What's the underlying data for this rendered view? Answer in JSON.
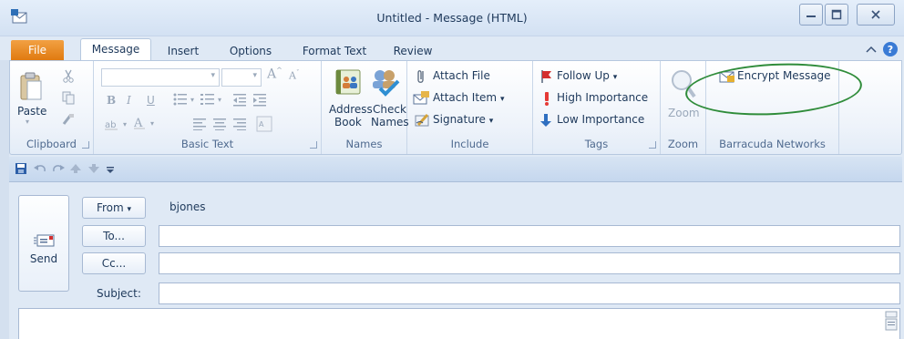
{
  "window": {
    "title": "Untitled  -  Message (HTML)"
  },
  "tabs": [
    {
      "label": "File"
    },
    {
      "label": "Message"
    },
    {
      "label": "Insert"
    },
    {
      "label": "Options"
    },
    {
      "label": "Format Text"
    },
    {
      "label": "Review"
    }
  ],
  "ribbon": {
    "clipboard": {
      "label": "Clipboard",
      "paste": "Paste"
    },
    "basic_text": {
      "label": "Basic Text"
    },
    "names": {
      "label": "Names",
      "address_book_1": "Address",
      "address_book_2": "Book",
      "check_names_1": "Check",
      "check_names_2": "Names"
    },
    "include": {
      "label": "Include",
      "attach_file": "Attach File",
      "attach_item": "Attach Item",
      "signature": "Signature"
    },
    "tags": {
      "label": "Tags",
      "follow_up": "Follow Up",
      "high_importance": "High Importance",
      "low_importance": "Low Importance"
    },
    "zoom": {
      "label": "Zoom",
      "zoom_button": "Zoom"
    },
    "barracuda": {
      "label": "Barracuda Networks",
      "encrypt": "Encrypt Message"
    }
  },
  "compose": {
    "send": "Send",
    "from_button": "From",
    "from_value": "bjones",
    "to_button": "To...",
    "cc_button": "Cc...",
    "subject_label": "Subject:"
  },
  "colors": {
    "file_tab": "#e07a10",
    "annotation": "#2f8c3a"
  }
}
